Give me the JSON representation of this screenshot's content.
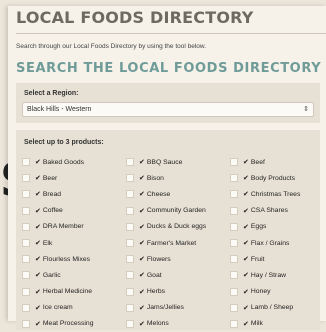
{
  "page": {
    "title": "LOCAL FOODS DIRECTORY",
    "intro": "Search through our Local Foods Directory by using the tool below.",
    "section_title": "SEARCH THE LOCAL FOODS DIRECTORY"
  },
  "region": {
    "label": "Select a Region:",
    "value": "Black Hills - Western"
  },
  "products": {
    "label": "Select up to 3 products:",
    "items": [
      "Baked Goods",
      "BBQ Sauce",
      "Beef",
      "Beer",
      "Bison",
      "Body Products",
      "Bread",
      "Cheese",
      "Christmas Trees",
      "Coffee",
      "Community Garden",
      "CSA Shares",
      "DRA Member",
      "Ducks & Duck eggs",
      "Eggs",
      "Elk",
      "Farmer's Market",
      "Flax / Grains",
      "Flourless Mixes",
      "Flowers",
      "Fruit",
      "Garlic",
      "Goat",
      "Hay / Straw",
      "Herbal Medicine",
      "Herbs",
      "Honey",
      "Ice cream",
      "Jams/Jellies",
      "Lamb / Sheep",
      "Meat Processing",
      "Melons",
      "Milk"
    ]
  },
  "icons": {
    "check": "checkmark-icon",
    "select_arrow": "updown-arrow-icon"
  },
  "colors": {
    "accent": "#6f9b98",
    "title": "#6e6a62"
  }
}
